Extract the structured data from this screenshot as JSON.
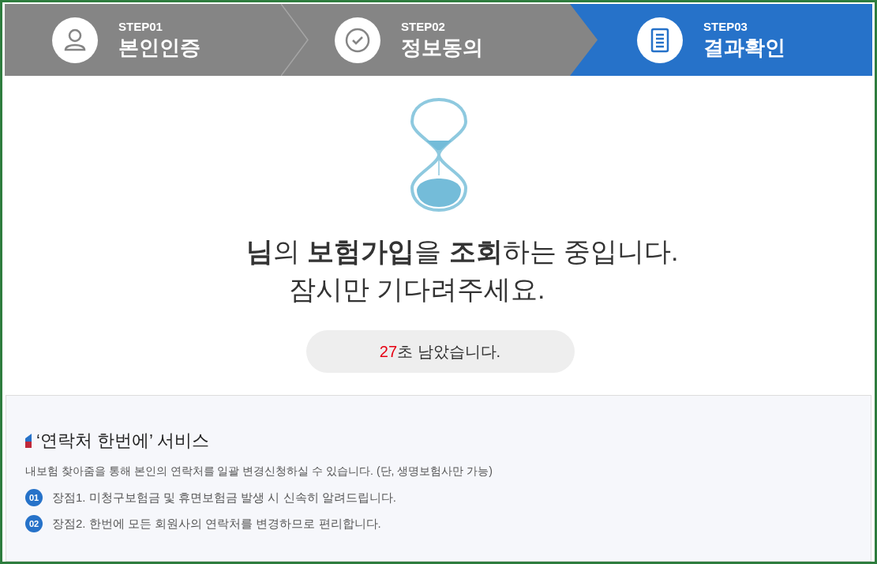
{
  "steps": [
    {
      "number": "STEP01",
      "label": "본인인증",
      "kind": "person",
      "selected": false
    },
    {
      "number": "STEP02",
      "label": "정보동의",
      "kind": "check",
      "selected": false
    },
    {
      "number": "STEP03",
      "label": "결과확인",
      "kind": "document",
      "selected": true
    }
  ],
  "status": {
    "headline": "**님**의 **보험가입**을 **조회**하는 중입니다.",
    "subline": "잠시만 기다려주세요.",
    "countdown": {
      "seconds": "27",
      "suffix": "초 남았습니다."
    }
  },
  "service": {
    "title": "‘연락처 한번에’ 서비스",
    "description": "내보험 찾아줌을 통해 본인의 연락처를 일괄 변경신청하실 수 있습니다. (단, 생명보험사만 가능)",
    "benefits": [
      {
        "number": "01",
        "text": "장점1. 미청구보험금 및 휴면보험금 발생 시 신속히 알려드립니다."
      },
      {
        "number": "02",
        "text": "장점2. 한번에 모든 회원사의 연락처를 변경하므로 편리합니다."
      }
    ]
  }
}
